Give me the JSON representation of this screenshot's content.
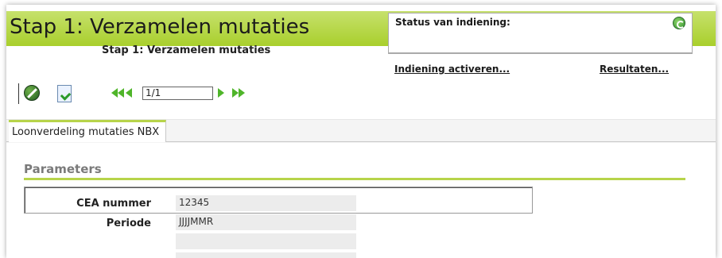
{
  "header": {
    "title": "Stap 1: Verzamelen mutaties",
    "subtitle": "Stap 1: Verzamelen mutaties"
  },
  "status": {
    "label": "Status van indiening:",
    "refresh_icon": "refresh-icon"
  },
  "links": {
    "activate": "Indiening activeren...",
    "results": "Resultaten..."
  },
  "toolbar": {
    "block_icon": "block-icon",
    "validate_icon": "validate-document-icon",
    "page_value": "1/1"
  },
  "tabs": [
    {
      "label": "Loonverdeling mutaties NBX",
      "active": true
    }
  ],
  "parameters": {
    "title": "Parameters",
    "fields": [
      {
        "label": "CEA nummer",
        "value": "12345"
      },
      {
        "label": "Periode",
        "value": "JJJJMMR"
      }
    ]
  },
  "colors": {
    "accent_green": "#b7d44a",
    "header_green": "#a9cf2c",
    "arrow_green": "#4fb52a"
  }
}
